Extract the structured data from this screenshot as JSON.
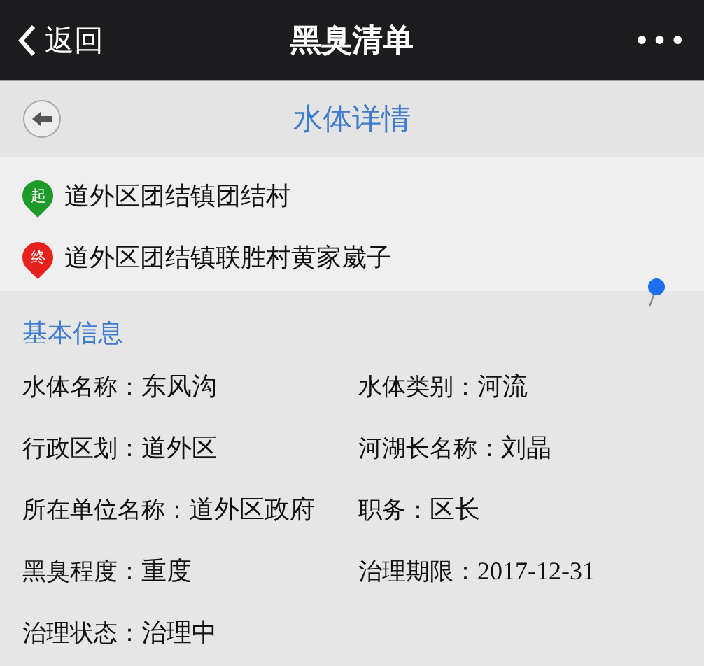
{
  "nav_bar": {
    "back_label": "返回",
    "title": "黑臭清单",
    "more": "•••"
  },
  "header": {
    "title": "水体详情"
  },
  "route": [
    {
      "kind": "start",
      "badge": "起",
      "place": "道外区团结镇团结村"
    },
    {
      "kind": "end",
      "badge": "终",
      "place": "道外区团结镇联胜村黄家崴子"
    }
  ],
  "basic_info": {
    "title": "基本信息",
    "fields": [
      {
        "label": "水体名称：",
        "value": "东风沟"
      },
      {
        "label": "水体类别：",
        "value": "河流"
      },
      {
        "label": "行政区划：",
        "value": "道外区"
      },
      {
        "label": "河湖长名称：",
        "value": "刘晶"
      },
      {
        "label": "所在单位名称：",
        "value": "道外区政府"
      },
      {
        "label": "职务：",
        "value": "区长"
      },
      {
        "label": "黑臭程度：",
        "value": "重度"
      },
      {
        "label": "治理期限：",
        "value": "2017-12-31"
      },
      {
        "label": "治理状态：",
        "value": "治理中"
      }
    ]
  }
}
